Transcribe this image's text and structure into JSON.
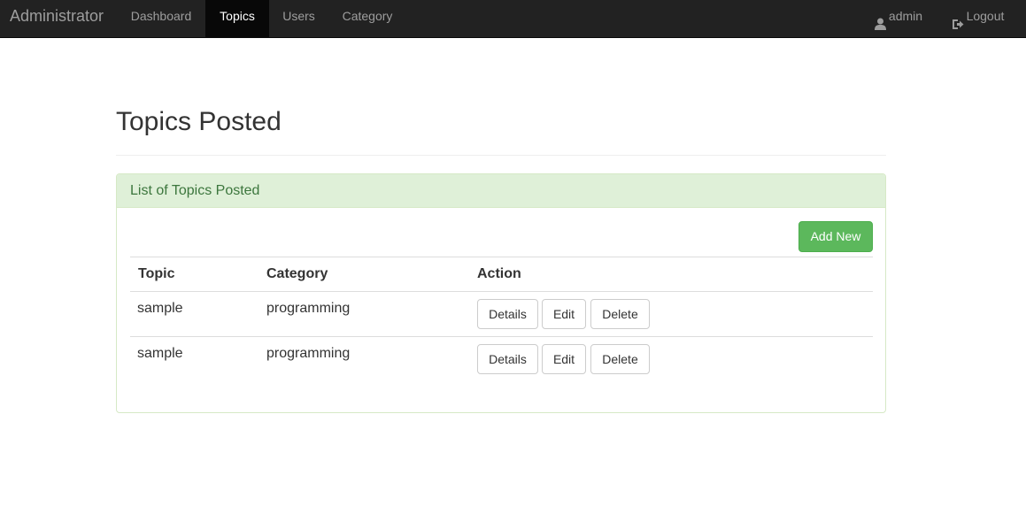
{
  "navbar": {
    "brand": "Administrator",
    "items": [
      {
        "label": "Dashboard",
        "active": false
      },
      {
        "label": "Topics",
        "active": true
      },
      {
        "label": "Users",
        "active": false
      },
      {
        "label": "Category",
        "active": false
      }
    ],
    "user": {
      "label": "admin",
      "icon": "user-icon"
    },
    "logout": {
      "label": "Logout",
      "icon": "logout-icon"
    }
  },
  "page": {
    "title": "Topics Posted"
  },
  "panel": {
    "heading": "List of Topics Posted",
    "add_button": "Add New",
    "columns": [
      "Topic",
      "Category",
      "Action"
    ],
    "rows": [
      {
        "topic": "sample",
        "category": "programming",
        "actions": [
          "Details",
          "Edit",
          "Delete"
        ]
      },
      {
        "topic": "sample",
        "category": "programming",
        "actions": [
          "Details",
          "Edit",
          "Delete"
        ]
      }
    ]
  },
  "colors": {
    "navbar_bg": "#222222",
    "panel_heading_bg": "#dff0d8",
    "panel_heading_text": "#3c763d",
    "success_button": "#5cb85c"
  }
}
